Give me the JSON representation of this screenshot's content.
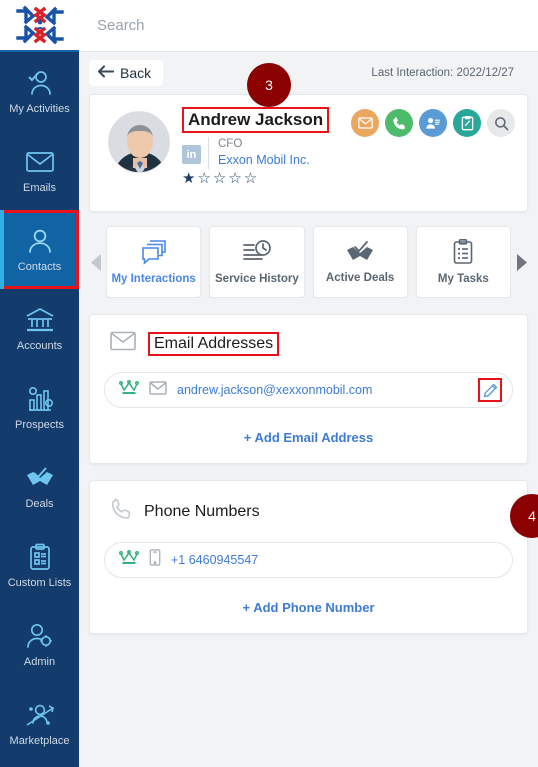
{
  "brand": {
    "logo_name": "company-pinwheel-logo",
    "accent_blue": "#1164a3",
    "sidebar_bg": "#133b6b",
    "highlight_red": "#e8121a",
    "badge_red": "#8b0000"
  },
  "sidebar": {
    "items": [
      {
        "label": "My Activities",
        "icon": "user-check-icon",
        "active": false
      },
      {
        "label": "Emails",
        "icon": "envelope-icon",
        "active": false
      },
      {
        "label": "Contacts",
        "icon": "user-icon",
        "active": true
      },
      {
        "label": "Accounts",
        "icon": "bank-icon",
        "active": false
      },
      {
        "label": "Prospects",
        "icon": "chart-gear-icon",
        "active": false
      },
      {
        "label": "Deals",
        "icon": "handshake-check-icon",
        "active": false
      },
      {
        "label": "Custom Lists",
        "icon": "clipboard-list-icon",
        "active": false
      },
      {
        "label": "Admin",
        "icon": "user-gear-icon",
        "active": false
      },
      {
        "label": "Marketplace",
        "icon": "user-network-icon",
        "active": false
      }
    ]
  },
  "search": {
    "placeholder": "Search"
  },
  "toolbar": {
    "back_label": "Back",
    "back_icon": "arrow-left-icon",
    "last_interaction": "Last Interaction: 2022/12/27"
  },
  "contact": {
    "name": "Andrew Jackson",
    "title": "CFO",
    "company": "Exxon Mobil Inc.",
    "linkedin_label": "in",
    "rating": 1,
    "rating_max": 5,
    "avatar_alt": "contact-photo",
    "actions": [
      {
        "name": "send-email-action",
        "icon": "envelope-icon",
        "color": "#eba65f"
      },
      {
        "name": "call-action",
        "icon": "phone-icon",
        "color": "#4cbb6c"
      },
      {
        "name": "meeting-action",
        "icon": "users-icon",
        "color": "#5b9bd5"
      },
      {
        "name": "note-action",
        "icon": "clipboard-pencil-icon",
        "color": "#2aa79b"
      },
      {
        "name": "search-action",
        "icon": "magnifier-icon",
        "color": "#e6e8ea"
      }
    ]
  },
  "tabs": {
    "prev_icon": "chevron-left-icon",
    "next_icon": "chevron-right-icon",
    "items": [
      {
        "label": "My Interactions",
        "icon": "chat-stack-icon",
        "active": true
      },
      {
        "label": "Service History",
        "icon": "clock-list-icon",
        "active": false
      },
      {
        "label": "Active Deals",
        "icon": "handshake-check-icon",
        "active": false
      },
      {
        "label": "My Tasks",
        "icon": "clipboard-list-icon",
        "active": false
      }
    ]
  },
  "email_section": {
    "title": "Email Addresses",
    "header_icon": "envelope-icon",
    "primary_icon": "crown-icon",
    "value_icon": "envelope-icon",
    "value": "andrew.jackson@xexxonmobil.com",
    "edit_icon": "pencil-icon",
    "add_label": "+ Add Email Address"
  },
  "phone_section": {
    "title": "Phone Numbers",
    "header_icon": "phone-icon",
    "primary_icon": "crown-icon",
    "value_icon": "mobile-icon",
    "value": "+1 6460945547",
    "add_label": "+ Add Phone Number"
  },
  "annotations": [
    {
      "id": "3",
      "label": "3"
    },
    {
      "id": "4",
      "label": "4"
    }
  ]
}
